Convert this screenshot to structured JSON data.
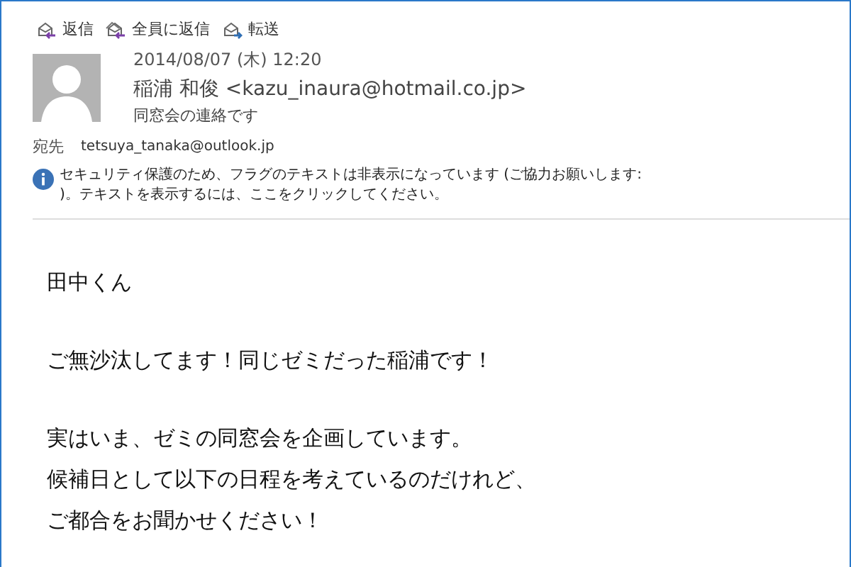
{
  "actions": [
    {
      "kind": "reply",
      "label": "返信"
    },
    {
      "kind": "reply-all",
      "label": "全員に返信"
    },
    {
      "kind": "forward",
      "label": "転送"
    }
  ],
  "header": {
    "date": "2014/08/07 (木) 12:20",
    "sender": "稲浦 和俊 <kazu_inaura@hotmail.co.jp>",
    "subject": "同窓会の連絡です",
    "to_label": "宛先",
    "to": "tetsuya_tanaka@outlook.jp"
  },
  "info_bar": {
    "text": "セキュリティ保護のため、フラグのテキストは非表示になっています (ご協力お願いします:\n)。テキストを表示するには、ここをクリックしてください。"
  },
  "body": [
    [
      "田中くん"
    ],
    [
      "ご無沙汰してます！同じゼミだった稲浦です！"
    ],
    [
      "実はいま、ゼミの同窓会を企画しています。",
      "候補日として以下の日程を考えているのだけれど、",
      "ご都合をお聞かせください！"
    ]
  ]
}
